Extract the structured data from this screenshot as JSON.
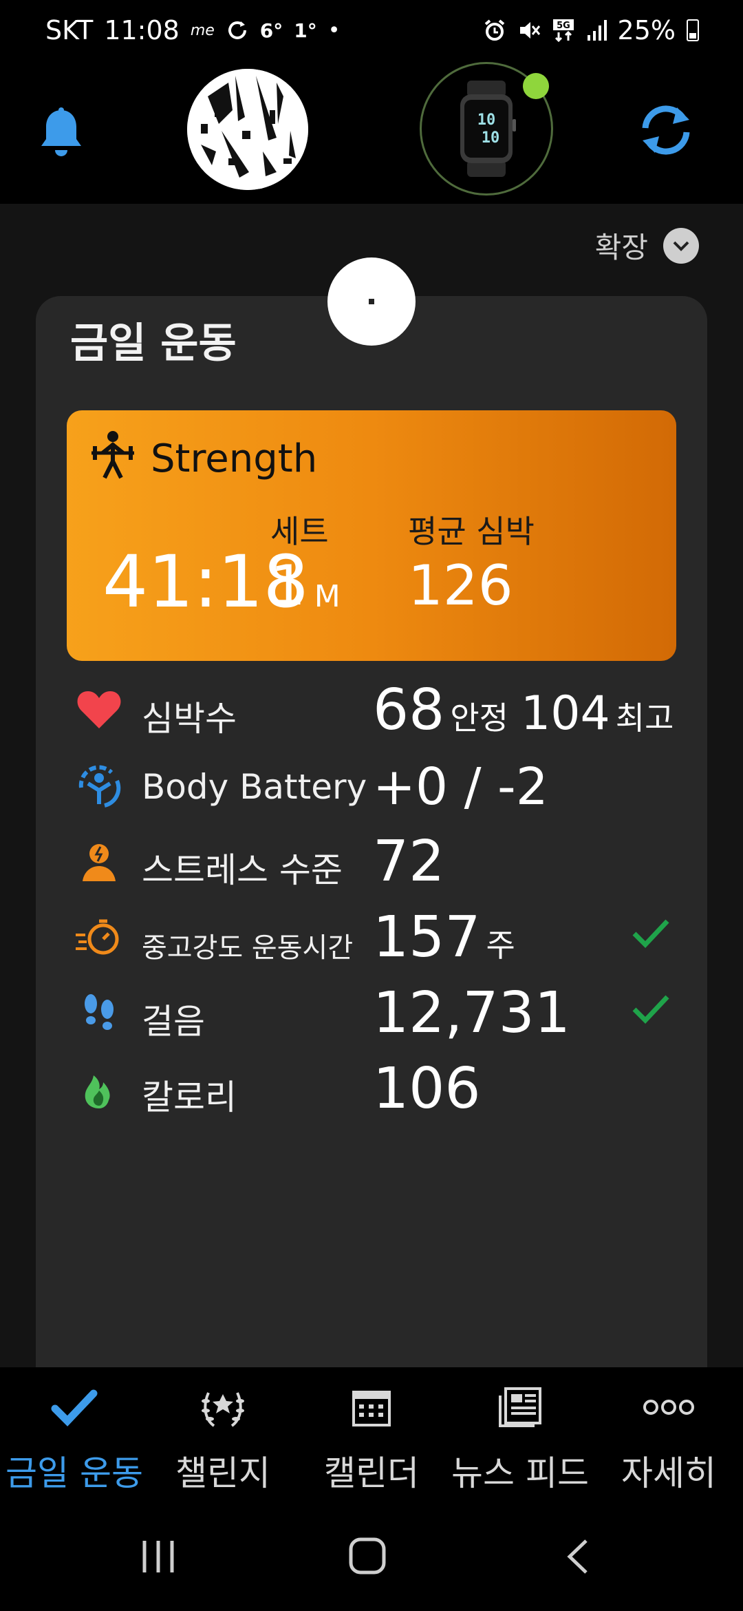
{
  "status_bar": {
    "carrier": "SKT",
    "time": "11:08",
    "temp_1": "6°",
    "temp_2": "1°",
    "battery": "25%"
  },
  "header": {
    "expand_label": "확장"
  },
  "today_card": {
    "title": "금일 운동",
    "activity": {
      "name": "Strength",
      "duration": "41:18",
      "duration_unit": "M",
      "sets_label": "세트",
      "sets_value": "1",
      "avg_hr_label": "평균 심박",
      "avg_hr_value": "126"
    },
    "metrics": [
      {
        "label": "심박수",
        "value": "68",
        "unit": "안정",
        "value2": "104",
        "unit2": "최고",
        "icon": "heart-icon",
        "color": "#f2444c"
      },
      {
        "label": "Body Battery",
        "value": "+0 / -2",
        "icon": "body-battery-icon",
        "color": "#2e8de2"
      },
      {
        "label": "스트레스 수준",
        "value": "72",
        "icon": "stress-icon",
        "color": "#f08a1a"
      },
      {
        "label": "중고강도 운동시간",
        "value": "157",
        "unit": "주",
        "icon": "intensity-minutes-icon",
        "color": "#f08a1a",
        "done": true
      },
      {
        "label": "걸음",
        "value": "12,731",
        "icon": "footsteps-icon",
        "color": "#4a9be8",
        "done": true
      },
      {
        "label": "칼로리",
        "value": "106",
        "icon": "flame-icon",
        "color": "#4fc25b"
      }
    ]
  },
  "bottom_nav": [
    {
      "label": "금일 운동",
      "icon": "checkmark-icon",
      "active": true
    },
    {
      "label": "챌린지",
      "icon": "laurel-icon",
      "active": false
    },
    {
      "label": "캘린더",
      "icon": "calendar-icon",
      "active": false
    },
    {
      "label": "뉴스 피드",
      "icon": "newsfeed-icon",
      "active": false
    },
    {
      "label": "자세히",
      "icon": "more-icon",
      "active": false
    }
  ],
  "colors": {
    "accent": "#3d9bea",
    "activity_start": "#f7a11b",
    "activity_end": "#d26a05",
    "check": "#1fa34a"
  }
}
